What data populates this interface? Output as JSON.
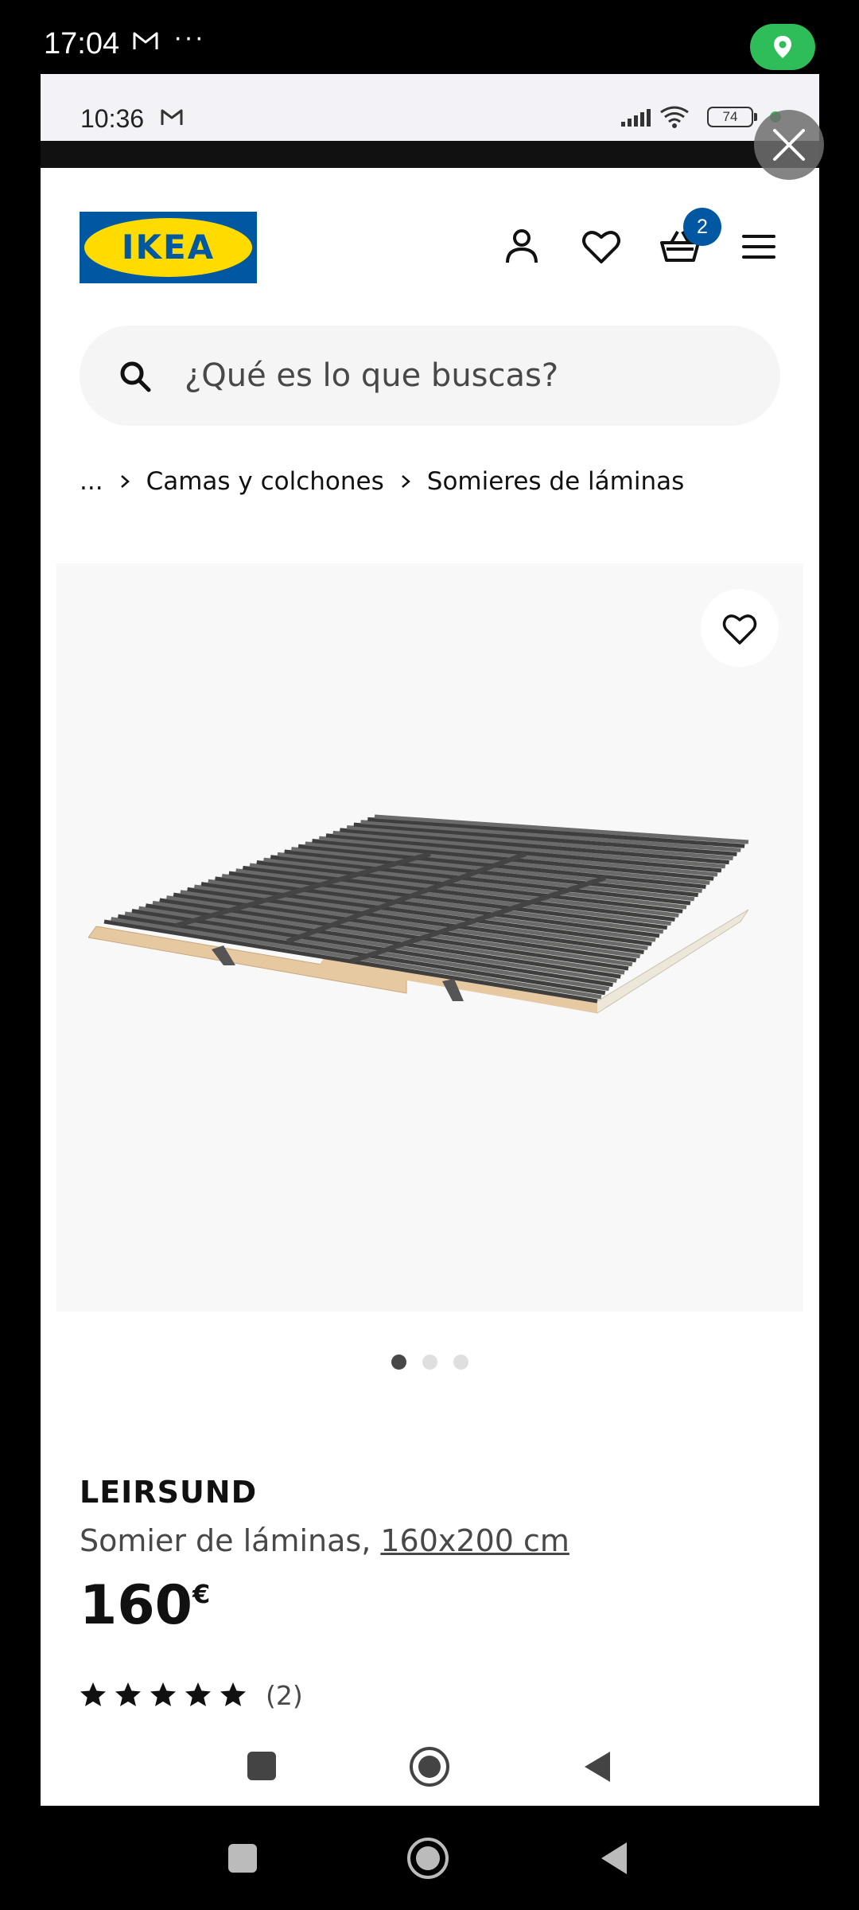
{
  "outer_status": {
    "time": "17:04",
    "more": "···"
  },
  "inner_status": {
    "time": "10:36",
    "battery": "74"
  },
  "header": {
    "logo_text": "IKEA",
    "cart_count": "2"
  },
  "search": {
    "placeholder": "¿Qué es lo que buscas?"
  },
  "breadcrumb": {
    "items": [
      "...",
      "Camas y colchones",
      "Somieres de láminas"
    ]
  },
  "product": {
    "name": "LEIRSUND",
    "description": "Somier de láminas,",
    "size": "160x200 cm",
    "price_amount": "160",
    "price_currency": "€",
    "rating_stars": 5,
    "rating_count": "(2)"
  },
  "carousel": {
    "count": 3,
    "active_index": 0
  },
  "colors": {
    "ikea_blue": "#0058a3",
    "ikea_yellow": "#ffdb00",
    "location_green": "#2ebd59"
  }
}
